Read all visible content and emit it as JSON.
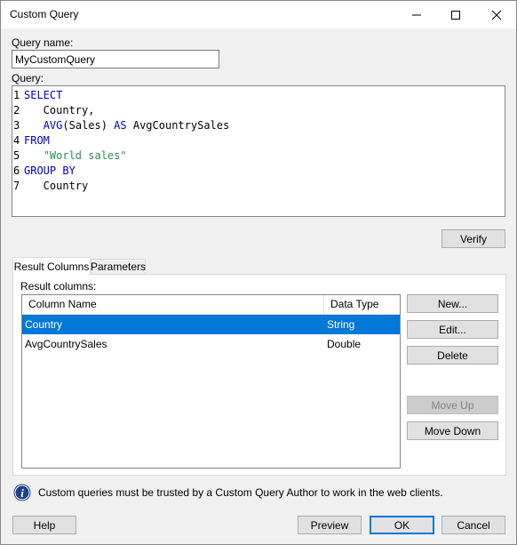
{
  "window": {
    "title": "Custom Query",
    "minimize_glyph": "—",
    "maximize_glyph": "☐",
    "close_glyph": "✕"
  },
  "query_name": {
    "label": "Query name:",
    "value": "MyCustomQuery"
  },
  "query": {
    "label": "Query:",
    "lines": [
      {
        "num": "1",
        "parts": [
          {
            "t": "SELECT",
            "c": "kw"
          }
        ]
      },
      {
        "num": "2",
        "parts": [
          {
            "t": "   Country,",
            "c": ""
          }
        ]
      },
      {
        "num": "3",
        "parts": [
          {
            "t": "   ",
            "c": ""
          },
          {
            "t": "AVG",
            "c": "kw"
          },
          {
            "t": "(Sales) ",
            "c": ""
          },
          {
            "t": "AS",
            "c": "kw"
          },
          {
            "t": " AvgCountrySales",
            "c": ""
          }
        ]
      },
      {
        "num": "4",
        "parts": [
          {
            "t": "FROM",
            "c": "kw"
          }
        ]
      },
      {
        "num": "5",
        "parts": [
          {
            "t": "   ",
            "c": ""
          },
          {
            "t": "\"World sales\"",
            "c": "str"
          }
        ]
      },
      {
        "num": "6",
        "parts": [
          {
            "t": "GROUP BY",
            "c": "kw"
          }
        ]
      },
      {
        "num": "7",
        "parts": [
          {
            "t": "   Country",
            "c": ""
          }
        ]
      }
    ]
  },
  "verify_label": "Verify",
  "tabs": {
    "result_columns": "Result Columns",
    "parameters": "Parameters"
  },
  "result_columns": {
    "label": "Result columns:",
    "headers": {
      "name": "Column Name",
      "type": "Data Type"
    },
    "rows": [
      {
        "name": "Country",
        "type": "String"
      },
      {
        "name": "AvgCountrySales",
        "type": "Double"
      }
    ],
    "selected_row_color": "#0078d7"
  },
  "side_buttons": {
    "new": "New...",
    "edit": "Edit...",
    "delete": "Delete",
    "move_up": "Move Up",
    "move_down": "Move Down"
  },
  "info": {
    "icon": "info-icon",
    "text": "Custom queries must be trusted by a Custom Query Author to work in the web clients."
  },
  "footer": {
    "help": "Help",
    "preview": "Preview",
    "ok": "OK",
    "cancel": "Cancel"
  },
  "colors": {
    "keyword": "#0000c8",
    "string": "#2e8b57",
    "accent": "#0078d7",
    "info_icon": "#1e3f8a"
  }
}
